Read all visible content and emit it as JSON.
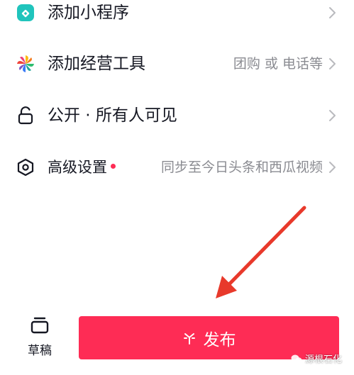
{
  "rows": [
    {
      "label": "添加小程序",
      "hint": "",
      "icon": "mini-program-icon"
    },
    {
      "label": "添加经营工具",
      "hint": "团购 或 电话等",
      "icon": "pinwheel-icon"
    },
    {
      "label": "公开 · 所有人可见",
      "hint": "",
      "icon": "unlock-icon"
    },
    {
      "label": "高级设置",
      "hint": "同步至今日头条和西瓜视频",
      "icon": "settings-hexagon-icon"
    }
  ],
  "footer": {
    "draft_label": "草稿",
    "publish_label": "发布"
  },
  "watermark": {
    "text": "源根石化"
  },
  "colors": {
    "accent": "#fe2c55",
    "arrow": "#e8392b",
    "text": "#161823",
    "hint": "#8a8b91",
    "mini_program": "#20c4bc"
  }
}
